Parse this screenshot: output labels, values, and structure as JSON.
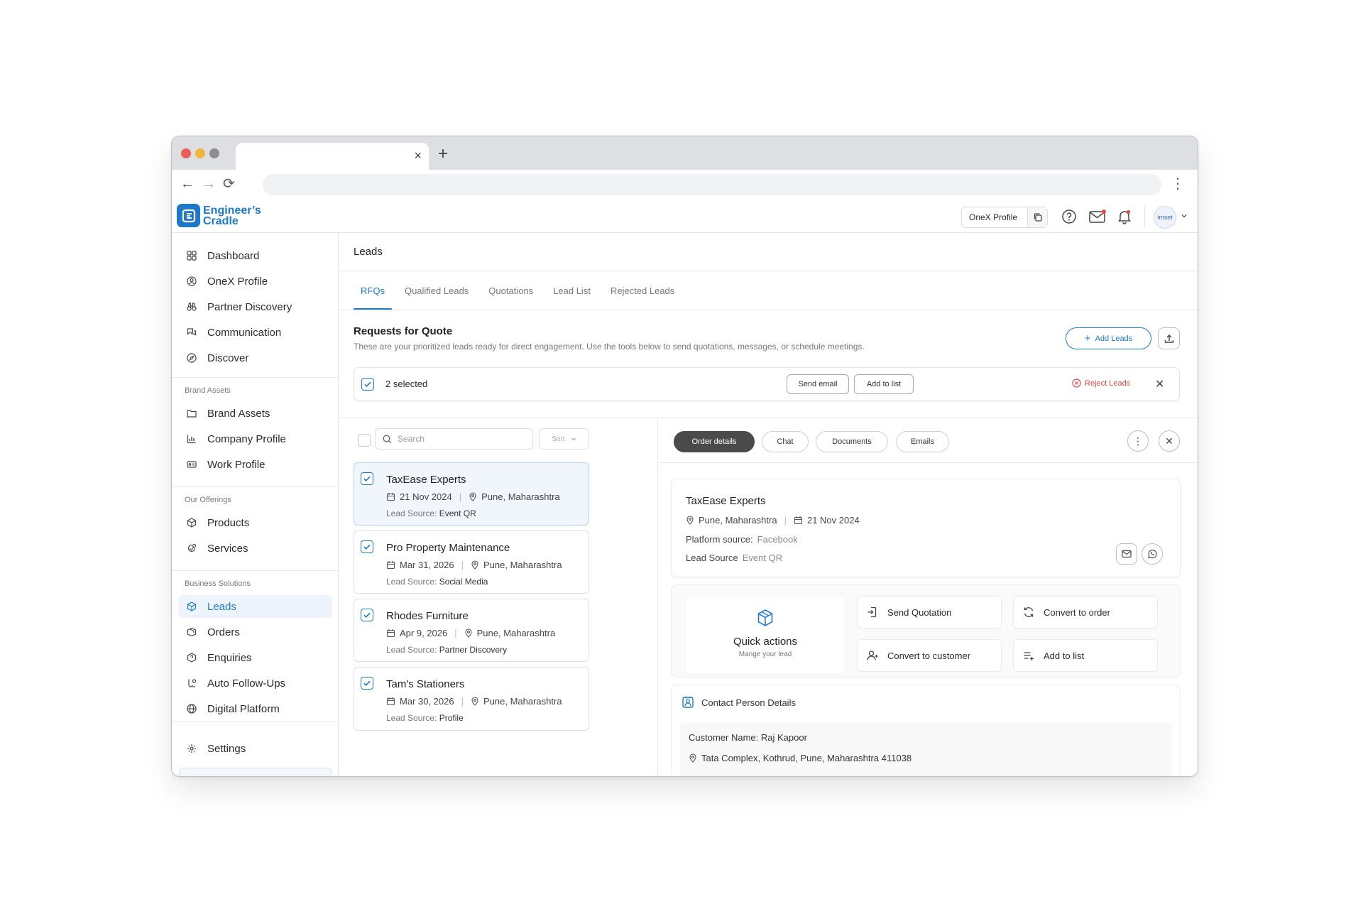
{
  "browser": {
    "tab_close": "×",
    "new_tab": "+",
    "back": "←",
    "forward": "→",
    "reload": "⟳",
    "menu": "⋮"
  },
  "brand": {
    "line1": "Engineer’s",
    "line2": "Cradle",
    "color": "#1f79c9"
  },
  "header": {
    "profile_button": "OneX Profile",
    "avatar_text": "imset"
  },
  "sidebar": {
    "main_items": [
      {
        "label": "Dashboard",
        "icon": "dashboard-icon"
      },
      {
        "label": "OneX Profile",
        "icon": "profile-icon"
      },
      {
        "label": "Partner Discovery",
        "icon": "binoculars-icon"
      },
      {
        "label": "Communication",
        "icon": "chat-icon"
      },
      {
        "label": "Discover",
        "icon": "compass-icon"
      }
    ],
    "brand_assets_label": "Brand Assets",
    "brand_assets_items": [
      {
        "label": "Brand Assets",
        "icon": "folder-icon"
      },
      {
        "label": "Company Profile",
        "icon": "chart-icon"
      },
      {
        "label": "Work Profile",
        "icon": "id-card-icon"
      }
    ],
    "offerings_label": "Our Offerings",
    "offerings_items": [
      {
        "label": "Products",
        "icon": "cube-icon"
      },
      {
        "label": "Services",
        "icon": "services-icon"
      }
    ],
    "business_label": "Business Solutions",
    "business_items": [
      {
        "label": "Leads",
        "icon": "leads-icon",
        "active": true
      },
      {
        "label": "Orders",
        "icon": "box-icon"
      },
      {
        "label": "Enquiries",
        "icon": "enquiry-icon"
      },
      {
        "label": "Auto Follow-Ups",
        "icon": "follow-up-icon"
      },
      {
        "label": "Digital Platform",
        "icon": "globe-icon"
      }
    ],
    "settings": "Settings"
  },
  "main": {
    "title": "Leads",
    "tabs": [
      "RFQs",
      "Qualified Leads",
      "Quotations",
      "Lead List",
      "Rejected Leads"
    ],
    "section_title": "Requests for Quote",
    "section_subtitle": "These are your prioritized leads ready for direct engagement. Use the tools below to send quotations, messages, or schedule meetings.",
    "add_leads": "Add Leads",
    "selection": {
      "count": "2 selected",
      "send_email": "Send email",
      "add_to_list": "Add to list",
      "reject": "Reject Leads"
    },
    "search_placeholder": "Search",
    "sort_label": "Sort",
    "leads": [
      {
        "name": "TaxEase Experts",
        "date": "21 Nov 2024",
        "location": "Pune, Maharashtra",
        "source_label": "Lead Source:",
        "source": "Event QR"
      },
      {
        "name": "Pro Property Maintenance",
        "date": "Mar 31, 2026",
        "location": "Pune, Maharashtra",
        "source_label": "Lead Source:",
        "source": "Social Media"
      },
      {
        "name": "Rhodes Furniture",
        "date": "Apr 9, 2026",
        "location": "Pune, Maharashtra",
        "source_label": "Lead Source:",
        "source": "Partner Discovery"
      },
      {
        "name": "Tam's Stationers",
        "date": "Mar 30, 2026",
        "location": "Pune, Maharashtra",
        "source_label": "Lead Source:",
        "source": "Profile"
      }
    ],
    "detail": {
      "tabs": [
        "Order details",
        "Chat",
        "Documents",
        "Emails"
      ],
      "company": "TaxEase Experts",
      "location": "Pune, Maharashtra",
      "date": "21 Nov 2024",
      "platform_label": "Platform source:",
      "platform": "Facebook",
      "lead_source_label": "Lead Source",
      "lead_source": "Event QR",
      "quick_title": "Quick actions",
      "quick_sub": "Mange your lead",
      "actions": [
        "Send Quotation",
        "Convert to order",
        "Convert to customer",
        "Add to list"
      ],
      "contact_title": "Contact Person Details",
      "customer_name": "Customer Name: Raj Kapoor",
      "address": "Tata Complex, Kothrud, Pune, Maharashtra 411038"
    }
  }
}
